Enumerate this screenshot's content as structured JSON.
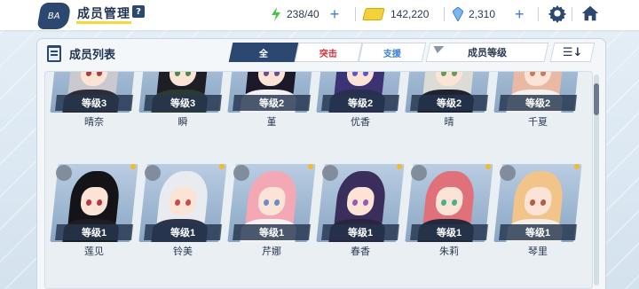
{
  "header": {
    "title": "成员管理",
    "help_label": "?",
    "back_label": "BA"
  },
  "resources": {
    "energy": "238/40",
    "credits": "142,220",
    "gems": "2,310",
    "plus_label": "+"
  },
  "panel": {
    "title": "成员列表",
    "filters": [
      "全",
      "突击",
      "支援"
    ],
    "sort_label": "成员等级",
    "order_label": "☰↓"
  },
  "colors": {
    "accent": "#2c4870",
    "striker": "#d8343d",
    "special": "#3a7fd8",
    "highlight": "#f5d83a"
  },
  "members": [
    {
      "name": "晴奈",
      "level": "等级3",
      "hair": "#c9c9cf",
      "eye": "#b33a3a",
      "outfit": "#2d2d34",
      "new": false,
      "pinned": false
    },
    {
      "name": "瞬",
      "level": "等级3",
      "hair": "#1e1e26",
      "eye": "#4a8a48",
      "outfit": "#2c3b32",
      "new": false,
      "pinned": false
    },
    {
      "name": "堇",
      "level": "等级2",
      "hair": "#1c1a2a",
      "eye": "#6b4d8e",
      "outfit": "#f2f2f5",
      "new": false,
      "pinned": false
    },
    {
      "name": "优香",
      "level": "等级2",
      "hair": "#3b3373",
      "eye": "#5b57c7",
      "outfit": "#2a2f52",
      "new": false,
      "pinned": false
    },
    {
      "name": "晴",
      "level": "等级2",
      "hair": "#dcdcd6",
      "eye": "#6a9a52",
      "outfit": "#1f2230",
      "new": false,
      "pinned": false
    },
    {
      "name": "千夏",
      "level": "等级2",
      "hair": "#e9b9a3",
      "eye": "#c97b5a",
      "outfit": "#f4f0ee",
      "new": false,
      "pinned": false
    },
    {
      "name": "莲见",
      "level": "等级1",
      "hair": "#141418",
      "eye": "#c0353c",
      "outfit": "#1d1d22",
      "new": true,
      "pinned": true
    },
    {
      "name": "铃美",
      "level": "等级1",
      "hair": "#e8ebf0",
      "eye": "#c94a4a",
      "outfit": "#2d3348",
      "new": true,
      "pinned": true
    },
    {
      "name": "芹娜",
      "level": "等级1",
      "hair": "#f4a8b6",
      "eye": "#6b8bc9",
      "outfit": "#f6f2f2",
      "new": true,
      "pinned": true
    },
    {
      "name": "春香",
      "level": "等级1",
      "hair": "#3a2f5c",
      "eye": "#9b59b6",
      "outfit": "#2a2440",
      "new": true,
      "pinned": true
    },
    {
      "name": "朱莉",
      "level": "等级1",
      "hair": "#e0707a",
      "eye": "#4fae8a",
      "outfit": "#24283a",
      "new": true,
      "pinned": true
    },
    {
      "name": "琴里",
      "level": "等级1",
      "hair": "#f2c48a",
      "eye": "#b85a4a",
      "outfit": "#f3eee6",
      "new": true,
      "pinned": true
    }
  ]
}
